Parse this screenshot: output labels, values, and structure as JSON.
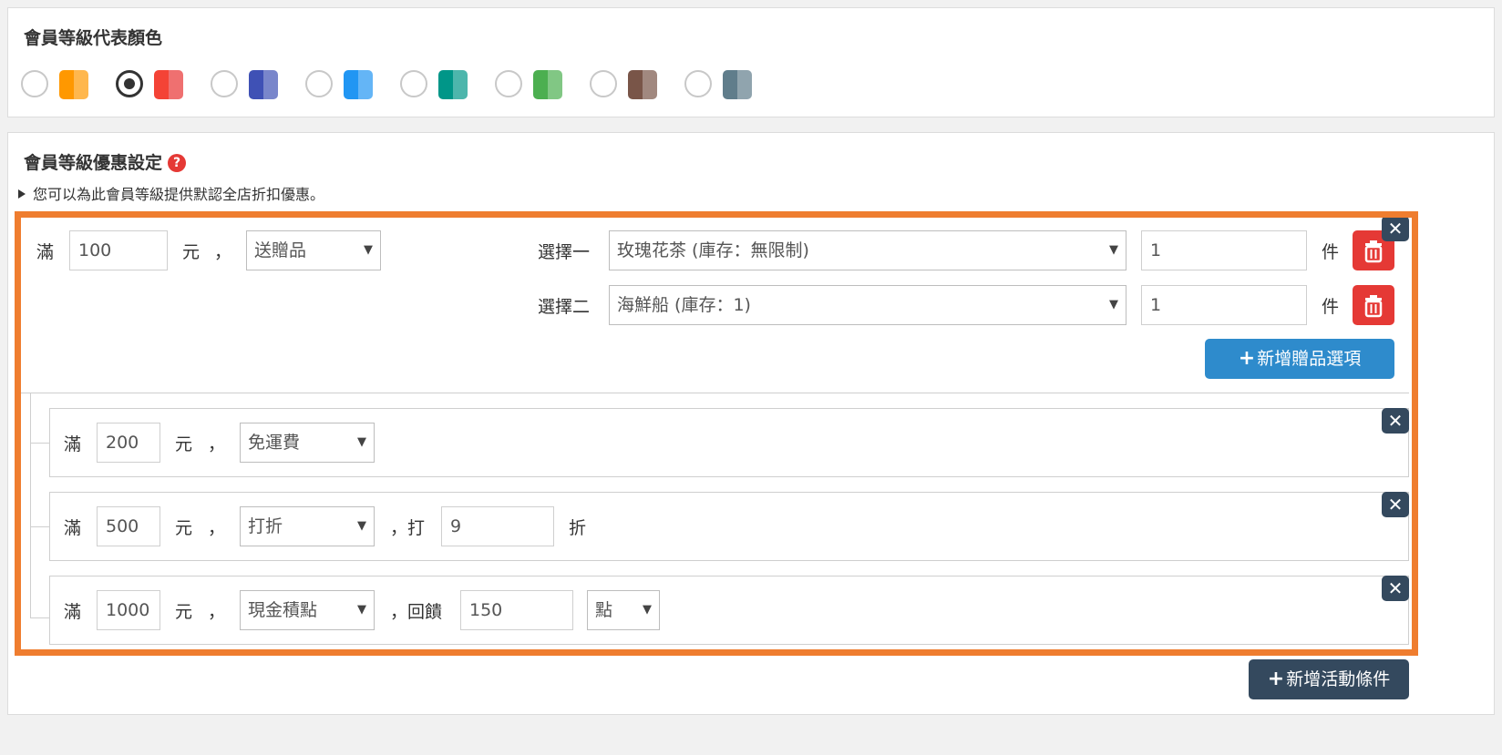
{
  "color_section": {
    "title": "會員等級代表顏色",
    "options": [
      {
        "checked": false,
        "colors": [
          "#ff9800",
          "#ffb74d"
        ]
      },
      {
        "checked": true,
        "colors": [
          "#f44336",
          "#ef7070"
        ]
      },
      {
        "checked": false,
        "colors": [
          "#3f51b5",
          "#7986cb"
        ]
      },
      {
        "checked": false,
        "colors": [
          "#2196f3",
          "#64b5f6"
        ]
      },
      {
        "checked": false,
        "colors": [
          "#009688",
          "#4db6ac"
        ]
      },
      {
        "checked": false,
        "colors": [
          "#4caf50",
          "#81c784"
        ]
      },
      {
        "checked": false,
        "colors": [
          "#795548",
          "#a1887f"
        ]
      },
      {
        "checked": false,
        "colors": [
          "#607d8b",
          "#90a4ae"
        ]
      }
    ]
  },
  "discount_section": {
    "title": "會員等級優惠設定",
    "help_icon": "?",
    "hint": "您可以為此會員等級提供默認全店折扣優惠。"
  },
  "main_rule": {
    "prefix": "滿",
    "amount": "100",
    "unit": "元",
    "comma": "，",
    "type": "送贈品",
    "gifts": [
      {
        "label": "選擇一",
        "product": "玫瑰花茶 (庫存：無限制)",
        "qty": "1",
        "qty_unit": "件"
      },
      {
        "label": "選擇二",
        "product": "海鮮船 (庫存：1)",
        "qty": "1",
        "qty_unit": "件"
      }
    ],
    "add_gift_label": "新增贈品選項",
    "close": "✕"
  },
  "sub_rules": [
    {
      "prefix": "滿",
      "amount": "200",
      "unit": "元",
      "comma": "，",
      "type": "免運費",
      "close": "✕"
    },
    {
      "prefix": "滿",
      "amount": "500",
      "unit": "元",
      "comma": "，",
      "type": "打折",
      "extra_prefix": "，打",
      "extra_value": "9",
      "extra_suffix": "折",
      "close": "✕"
    },
    {
      "prefix": "滿",
      "amount": "1000",
      "unit": "元",
      "comma": "，",
      "type": "現金積點",
      "extra_prefix": "，回饋",
      "extra_value": "150",
      "extra_unit": "點",
      "close": "✕"
    }
  ],
  "add_condition_label": "新增活動條件",
  "plus": "+",
  "caret": "▼"
}
